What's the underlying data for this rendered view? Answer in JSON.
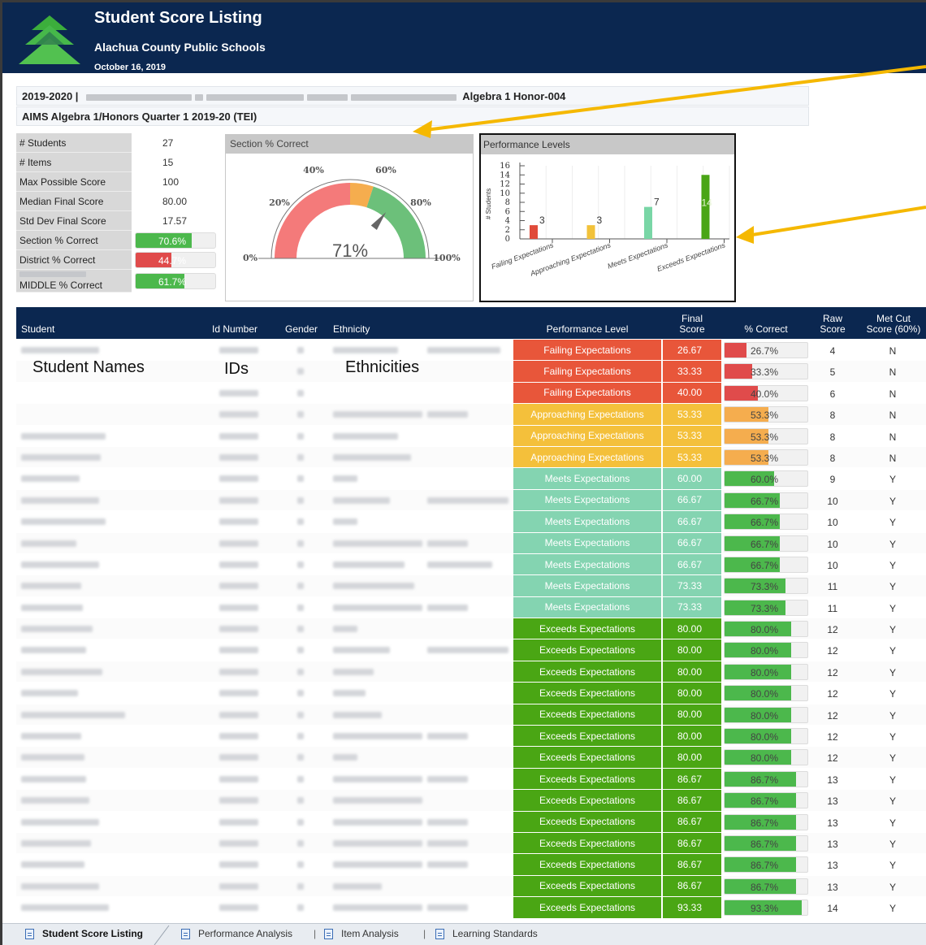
{
  "header": {
    "title": "Student Score Listing",
    "district": "Alachua County Public Schools",
    "date": "October 16, 2019"
  },
  "info": {
    "year_prefix": "2019-2020 |",
    "course": "Algebra 1 Honor-004",
    "assessment": "AIMS Algebra 1/Honors Quarter 1 2019-20 (TEI)"
  },
  "stats": [
    {
      "label": "# Students",
      "value": "27"
    },
    {
      "label": "# Items",
      "value": "15"
    },
    {
      "label": "Max Possible Score",
      "value": "100"
    },
    {
      "label": "Median Final Score",
      "value": "80.00"
    },
    {
      "label": "Std Dev Final Score",
      "value": "17.57"
    }
  ],
  "stat_bars": [
    {
      "label": "Section % Correct",
      "text": "70.6%",
      "pct": 70.6,
      "color": "#4cb84c"
    },
    {
      "label": "District % Correct",
      "text": "44.7%",
      "pct": 44.7,
      "color": "#e04b4b"
    },
    {
      "label": "MIDDLE % Correct",
      "text": "61.7%",
      "pct": 61.7,
      "color": "#4cb84c"
    }
  ],
  "gauge": {
    "title": "Section % Correct",
    "value": 71,
    "value_text": "71%",
    "ticks": [
      "0%",
      "20%",
      "40%",
      "60%",
      "80%",
      "100%"
    ],
    "colors": {
      "low": "#f47a7a",
      "mid": "#f5ad4e",
      "high": "#6cc07a"
    }
  },
  "chart_data": {
    "type": "bar",
    "title": "Performance Levels",
    "ylabel": "# Students",
    "categories": [
      "Failing Expectations",
      "Approaching Expectations",
      "Meets Expectations",
      "Exceeds Expectations"
    ],
    "values": [
      3,
      3,
      7,
      14
    ],
    "value_labels": [
      "3",
      "3",
      "7",
      "14"
    ],
    "colors": [
      "#e04b3a",
      "#f2c23a",
      "#79d6a6",
      "#4aa516"
    ],
    "yticks": [
      "0",
      "2",
      "4",
      "6",
      "8",
      "10",
      "12",
      "14",
      "16"
    ],
    "ylim": [
      0,
      16
    ]
  },
  "table": {
    "headers": {
      "student": "Student",
      "id": "Id Number",
      "gender": "Gender",
      "ethnicity": "Ethnicity",
      "performance": "Performance Level",
      "final_1": "Final",
      "final_2": "Score",
      "pct": "% Correct",
      "raw_1": "Raw",
      "raw_2": "Score",
      "met_1": "Met Cut",
      "met_2": "Score (60%)"
    },
    "overlay_labels": {
      "names": "Student Names",
      "ids": "IDs",
      "ethnicities": "Ethnicities"
    },
    "level_colors": {
      "Failing Expectations": "#e8563a",
      "Approaching Expectations": "#f4c03b",
      "Meets Expectations": "#84d4b1",
      "Exceeds Expectations": "#4aa614"
    },
    "bar_colors": {
      "Failing Expectations": "#e04b4b",
      "Approaching Expectations": "#f5ad4e",
      "Meets Expectations": "#4cb84c",
      "Exceeds Expectations": "#4cb84c"
    },
    "rows": [
      {
        "level": "Failing Expectations",
        "final": "26.67",
        "pct_text": "26.7%",
        "pct": 26.7,
        "raw": "4",
        "met": "N"
      },
      {
        "level": "Failing Expectations",
        "final": "33.33",
        "pct_text": "33.3%",
        "pct": 33.3,
        "raw": "5",
        "met": "N"
      },
      {
        "level": "Failing Expectations",
        "final": "40.00",
        "pct_text": "40.0%",
        "pct": 40.0,
        "raw": "6",
        "met": "N"
      },
      {
        "level": "Approaching Expectations",
        "final": "53.33",
        "pct_text": "53.3%",
        "pct": 53.3,
        "raw": "8",
        "met": "N"
      },
      {
        "level": "Approaching Expectations",
        "final": "53.33",
        "pct_text": "53.3%",
        "pct": 53.3,
        "raw": "8",
        "met": "N"
      },
      {
        "level": "Approaching Expectations",
        "final": "53.33",
        "pct_text": "53.3%",
        "pct": 53.3,
        "raw": "8",
        "met": "N"
      },
      {
        "level": "Meets Expectations",
        "final": "60.00",
        "pct_text": "60.0%",
        "pct": 60.0,
        "raw": "9",
        "met": "Y"
      },
      {
        "level": "Meets Expectations",
        "final": "66.67",
        "pct_text": "66.7%",
        "pct": 66.7,
        "raw": "10",
        "met": "Y"
      },
      {
        "level": "Meets Expectations",
        "final": "66.67",
        "pct_text": "66.7%",
        "pct": 66.7,
        "raw": "10",
        "met": "Y"
      },
      {
        "level": "Meets Expectations",
        "final": "66.67",
        "pct_text": "66.7%",
        "pct": 66.7,
        "raw": "10",
        "met": "Y"
      },
      {
        "level": "Meets Expectations",
        "final": "66.67",
        "pct_text": "66.7%",
        "pct": 66.7,
        "raw": "10",
        "met": "Y"
      },
      {
        "level": "Meets Expectations",
        "final": "73.33",
        "pct_text": "73.3%",
        "pct": 73.3,
        "raw": "11",
        "met": "Y"
      },
      {
        "level": "Meets Expectations",
        "final": "73.33",
        "pct_text": "73.3%",
        "pct": 73.3,
        "raw": "11",
        "met": "Y"
      },
      {
        "level": "Exceeds Expectations",
        "final": "80.00",
        "pct_text": "80.0%",
        "pct": 80.0,
        "raw": "12",
        "met": "Y"
      },
      {
        "level": "Exceeds Expectations",
        "final": "80.00",
        "pct_text": "80.0%",
        "pct": 80.0,
        "raw": "12",
        "met": "Y"
      },
      {
        "level": "Exceeds Expectations",
        "final": "80.00",
        "pct_text": "80.0%",
        "pct": 80.0,
        "raw": "12",
        "met": "Y"
      },
      {
        "level": "Exceeds Expectations",
        "final": "80.00",
        "pct_text": "80.0%",
        "pct": 80.0,
        "raw": "12",
        "met": "Y"
      },
      {
        "level": "Exceeds Expectations",
        "final": "80.00",
        "pct_text": "80.0%",
        "pct": 80.0,
        "raw": "12",
        "met": "Y"
      },
      {
        "level": "Exceeds Expectations",
        "final": "80.00",
        "pct_text": "80.0%",
        "pct": 80.0,
        "raw": "12",
        "met": "Y"
      },
      {
        "level": "Exceeds Expectations",
        "final": "80.00",
        "pct_text": "80.0%",
        "pct": 80.0,
        "raw": "12",
        "met": "Y"
      },
      {
        "level": "Exceeds Expectations",
        "final": "86.67",
        "pct_text": "86.7%",
        "pct": 86.7,
        "raw": "13",
        "met": "Y"
      },
      {
        "level": "Exceeds Expectations",
        "final": "86.67",
        "pct_text": "86.7%",
        "pct": 86.7,
        "raw": "13",
        "met": "Y"
      },
      {
        "level": "Exceeds Expectations",
        "final": "86.67",
        "pct_text": "86.7%",
        "pct": 86.7,
        "raw": "13",
        "met": "Y"
      },
      {
        "level": "Exceeds Expectations",
        "final": "86.67",
        "pct_text": "86.7%",
        "pct": 86.7,
        "raw": "13",
        "met": "Y"
      },
      {
        "level": "Exceeds Expectations",
        "final": "86.67",
        "pct_text": "86.7%",
        "pct": 86.7,
        "raw": "13",
        "met": "Y"
      },
      {
        "level": "Exceeds Expectations",
        "final": "86.67",
        "pct_text": "86.7%",
        "pct": 86.7,
        "raw": "13",
        "met": "Y"
      },
      {
        "level": "Exceeds Expectations",
        "final": "93.33",
        "pct_text": "93.3%",
        "pct": 93.3,
        "raw": "14",
        "met": "Y"
      }
    ]
  },
  "tabs": [
    {
      "label": "Student Score Listing",
      "active": true
    },
    {
      "label": "Performance Analysis",
      "active": false
    },
    {
      "label": "Item Analysis",
      "active": false
    },
    {
      "label": "Learning Standards",
      "active": false
    }
  ],
  "annotation_color": "#f5b800"
}
